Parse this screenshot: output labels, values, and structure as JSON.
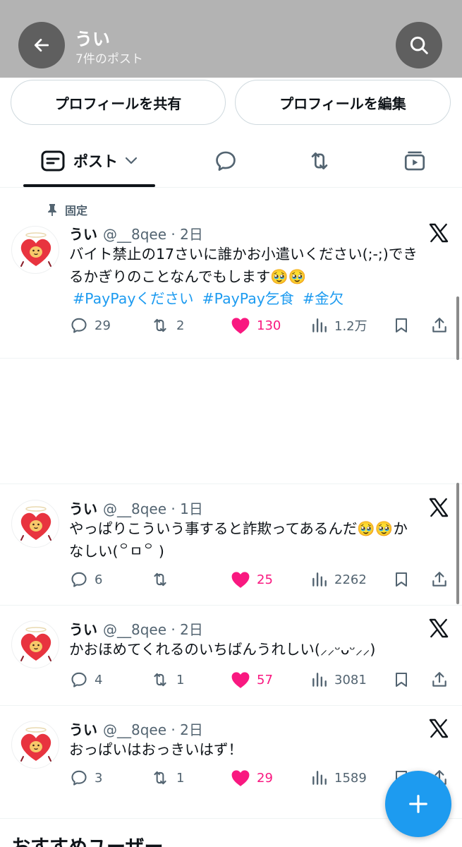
{
  "header": {
    "title": "うい",
    "subtitle": "7件のポスト"
  },
  "profile_buttons": {
    "share": "プロフィールを共有",
    "edit": "プロフィールを編集"
  },
  "tabs": {
    "posts_label": "ポスト"
  },
  "pinned_label": "固定",
  "posts": [
    {
      "name": "うい",
      "meta": "@__8qee · 2日",
      "text_line1": "バイト禁止の17さいに誰かお小遣いください(;-;)でき",
      "text_line2": "るかぎりのことなんでもします🥹🥹",
      "hashtags": [
        "#PayPayください",
        "#PayPay乞食",
        "#金欠"
      ],
      "replies": "29",
      "reposts": "2",
      "likes": "130",
      "views": "1.2万"
    },
    {
      "name": "うい",
      "meta": "@__8qee · 1日",
      "text_line1": "やっぱりこういう事すると詐欺ってあるんだ🥹🥹か",
      "text_line2": "なしい(꒪ㅁ꒪ )",
      "replies": "6",
      "reposts": "",
      "likes": "25",
      "views": "2262"
    },
    {
      "name": "うい",
      "meta": "@__8qee · 2日",
      "text_line1": "かおほめてくれるのいちばんうれしい(⸝⸝ᵕᴗᵕ⸝⸝)",
      "replies": "4",
      "reposts": "1",
      "likes": "57",
      "views": "3081"
    },
    {
      "name": "うい",
      "meta": "@__8qee · 2日",
      "text_line1": "おっぱいはおっきいはず！",
      "replies": "3",
      "reposts": "1",
      "likes": "29",
      "views": "1589"
    }
  ],
  "recommended_title": "おすすめユーザー",
  "colors": {
    "accent": "#1d9bf0",
    "like": "#f91880",
    "muted": "#536471",
    "header_bg": "#b3b3b3"
  },
  "icons": [
    "back-arrow-icon",
    "search-icon",
    "posts-tab-icon",
    "chevron-down-icon",
    "reply-bubble-icon",
    "repost-icon",
    "media-icon",
    "pin-icon",
    "x-logo-icon",
    "heart-icon",
    "views-icon",
    "bookmark-icon",
    "share-icon",
    "plus-icon"
  ]
}
